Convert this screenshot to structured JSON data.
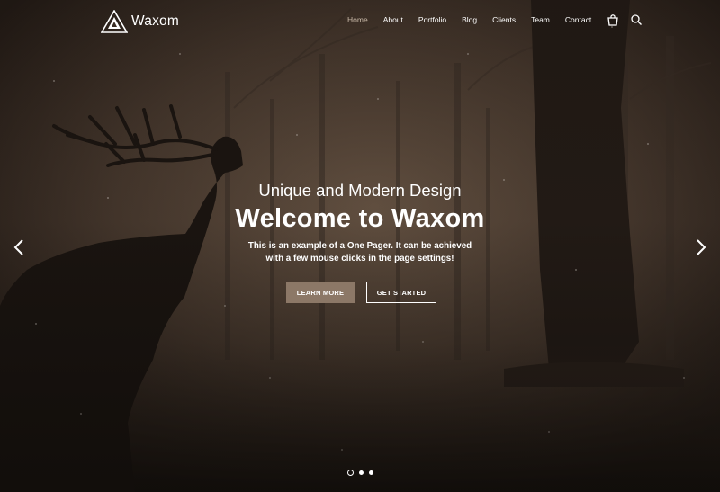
{
  "brand": {
    "name": "Waxom",
    "logo_icon": "triangle-logo-icon"
  },
  "nav": {
    "items": [
      {
        "label": "Home",
        "active": true
      },
      {
        "label": "About",
        "active": false
      },
      {
        "label": "Portfolio",
        "active": false
      },
      {
        "label": "Blog",
        "active": false
      },
      {
        "label": "Clients",
        "active": false
      },
      {
        "label": "Team",
        "active": false
      },
      {
        "label": "Contact",
        "active": false
      }
    ],
    "cart_icon": "shopping-bag-icon",
    "search_icon": "search-icon"
  },
  "hero": {
    "subtitle": "Unique and Modern Design",
    "title": "Welcome to Waxom",
    "description_line1": "This is an example of a One Pager. It can be achieved",
    "description_line2": "with a few mouse clicks in the page settings!",
    "learn_more_label": "LEARN MORE",
    "get_started_label": "GET STARTED"
  },
  "slider": {
    "prev_icon": "chevron-left-icon",
    "next_icon": "chevron-right-icon",
    "slide_count": 3,
    "active_slide": 1
  },
  "colors": {
    "accent": "#8c7867",
    "nav_active": "#c9b9a8",
    "background": "#2a221c"
  }
}
